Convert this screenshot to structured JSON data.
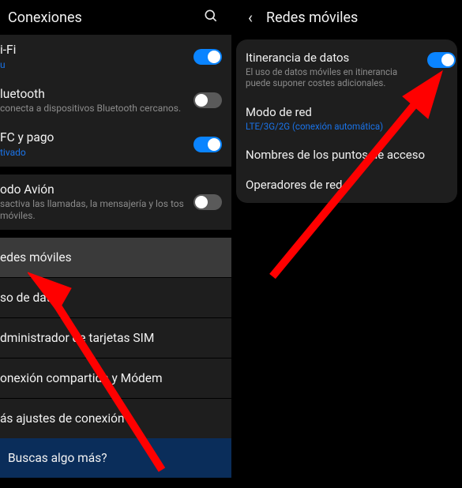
{
  "left": {
    "title": "Conexiones",
    "wifi": {
      "label": "i-Fi",
      "sub": "u",
      "on": true
    },
    "bluetooth": {
      "label": "luetooth",
      "sub": "conecta a dispositivos Bluetooth cercanos.",
      "on": false
    },
    "nfc": {
      "label": "FC y pago",
      "sub": "tivado",
      "on": true
    },
    "airplane": {
      "label": "odo Avión",
      "sub": "sactiva las llamadas, la mensajería y los tos móviles.",
      "on": false
    },
    "items": {
      "mobile_networks": "edes móviles",
      "data_usage": "so de datos",
      "sim_manager": "dministrador de tarjetas SIM",
      "tethering": "onexión compartida y Módem",
      "more": "ás ajustes de conexión"
    },
    "promo": "Buscas algo más?"
  },
  "right": {
    "title": "Redes móviles",
    "roaming": {
      "label": "Itinerancia de datos",
      "sub": "El uso de datos móviles en itinerancia puede suponer costes adicionales.",
      "on": true
    },
    "mode": {
      "label": "Modo de red",
      "sub": "LTE/3G/2G (conexión automática)"
    },
    "apn": {
      "label": "Nombres de los puntos de acceso"
    },
    "operators": {
      "label": "Operadores de red"
    }
  }
}
